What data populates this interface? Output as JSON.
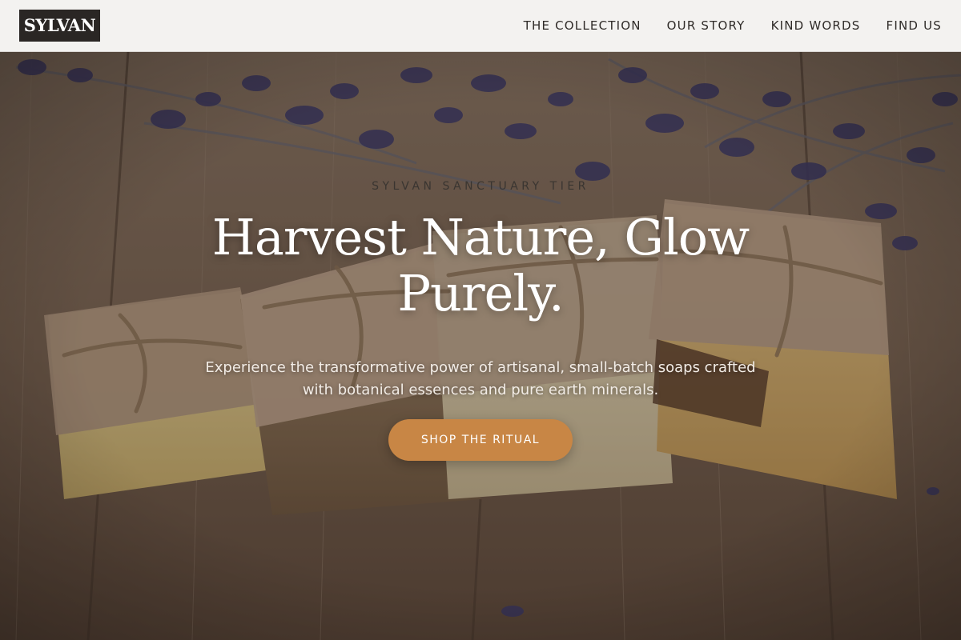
{
  "brand": {
    "logo_text": "SYLVAN"
  },
  "nav": {
    "items": [
      {
        "label": "THE COLLECTION"
      },
      {
        "label": "OUR STORY"
      },
      {
        "label": "KIND WORDS"
      },
      {
        "label": "FIND US"
      }
    ]
  },
  "hero": {
    "eyebrow": "SYLVAN SANCTUARY TIER",
    "headline": "Harvest Nature, Glow Purely.",
    "subtext": "Experience the transformative power of artisanal, small-batch soaps crafted with botanical essences and pure earth minerals.",
    "cta_label": "SHOP THE RITUAL"
  },
  "colors": {
    "accent": "#c88645",
    "header_bg": "#f3f2f0",
    "logo_bg": "#2a2624",
    "text_dark": "#2f2b28"
  }
}
